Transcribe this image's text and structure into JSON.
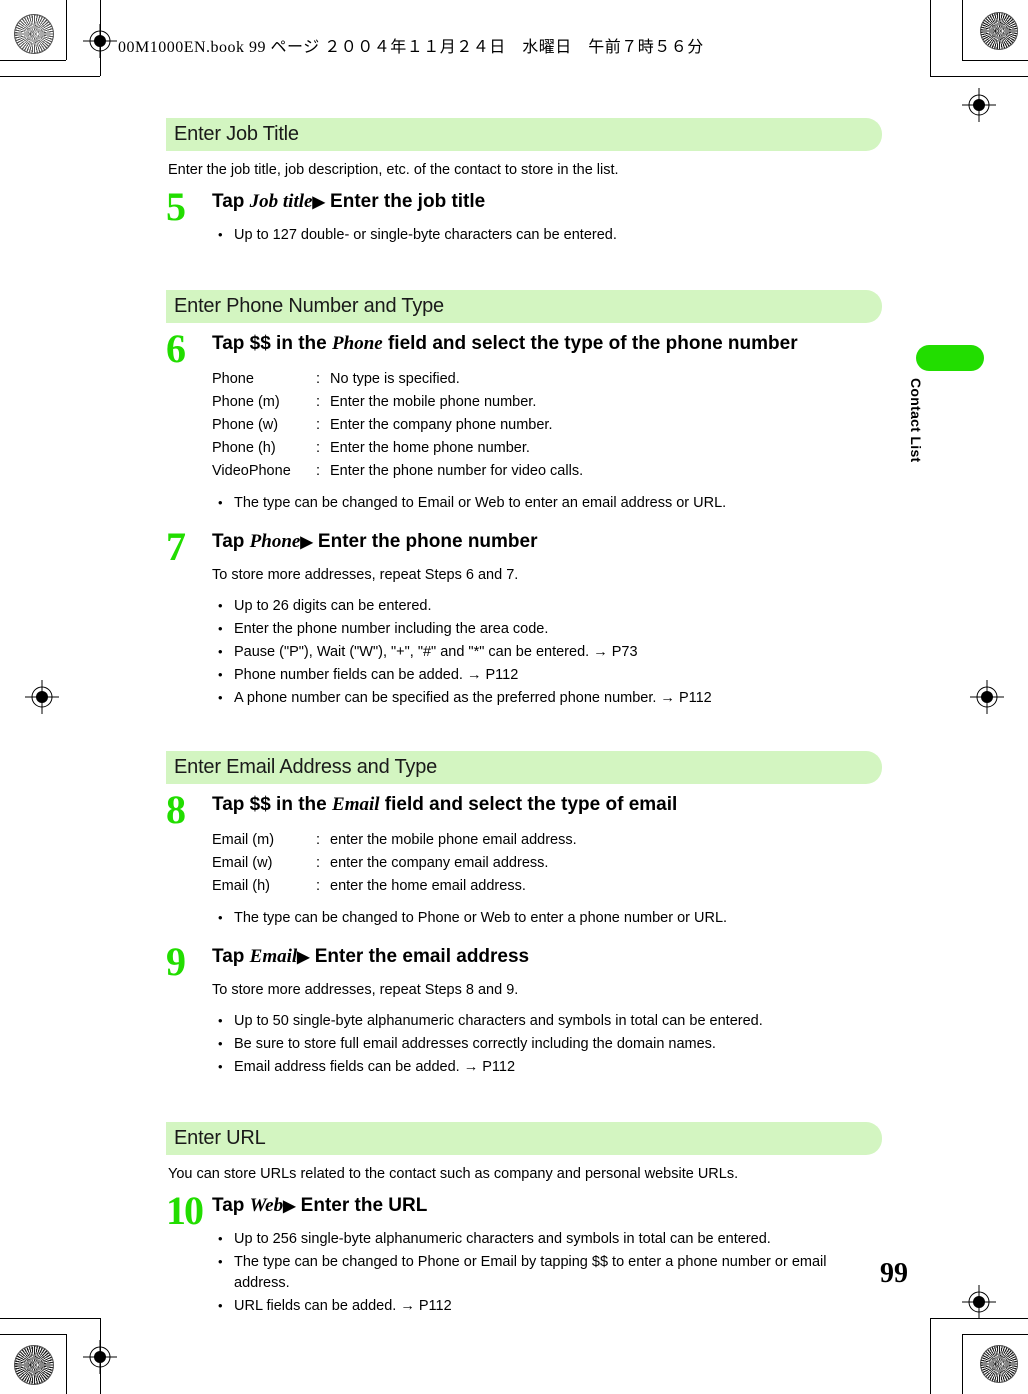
{
  "slug": {
    "text": "00M1000EN.book   99 ページ   ２００４年１１月２４日　水曜日　午前７時５６分"
  },
  "side_tab": {
    "label": "Contact List"
  },
  "folio": {
    "page_number": "99"
  },
  "colors": {
    "band_green": "#d3f5c1",
    "accent_green": "#22dd00",
    "text": "#000000"
  },
  "glyphs": {
    "triangle": "▶",
    "arrow": "→",
    "bullet": "•"
  },
  "sections": [
    {
      "heading": "Enter Job Title",
      "intro": "Enter the job title, job description, etc. of the contact to store in the list.",
      "steps": [
        {
          "number": "5",
          "head_pre": "Tap ",
          "head_field": "Job title",
          "head_post": " Enter the job title",
          "bullets": [
            "Up to 127 double- or single-byte characters can be entered."
          ]
        }
      ]
    },
    {
      "heading": "Enter Phone Number and Type",
      "steps": [
        {
          "number": "6",
          "head_pre": "Tap $$ in the ",
          "head_field": "Phone",
          "head_post": " field and select the type of the phone number",
          "definitions": [
            {
              "term": "Phone",
              "desc": "No type is specified."
            },
            {
              "term": "Phone (m)",
              "desc": "Enter the mobile phone number."
            },
            {
              "term": "Phone (w)",
              "desc": "Enter the company phone number."
            },
            {
              "term": "Phone (h)",
              "desc": "Enter the home phone number."
            },
            {
              "term": "VideoPhone",
              "desc": "Enter the phone number for video calls."
            }
          ],
          "bullets": [
            "The type can be changed to Email or Web to enter an email address or URL."
          ]
        },
        {
          "number": "7",
          "head_pre": "Tap ",
          "head_field": "Phone",
          "head_post": " Enter the phone number",
          "note": "To store more addresses, repeat Steps 6 and 7.",
          "bullets": [
            "Up to 26 digits can be entered.",
            "Enter the phone number including the area code.",
            "Pause (\"P\"), Wait (\"W\"), \"+\", \"#\" and \"*\" can be entered. → P73",
            "Phone number fields can be added. → P112",
            "A phone number can be specified as the preferred phone number. → P112"
          ]
        }
      ]
    },
    {
      "heading": "Enter Email Address and Type",
      "steps": [
        {
          "number": "8",
          "head_pre": "Tap $$ in the ",
          "head_field": "Email",
          "head_post": " field and select the type of email",
          "definitions": [
            {
              "term": "Email (m)",
              "desc": "enter the mobile phone email address."
            },
            {
              "term": "Email (w)",
              "desc": "enter the company email address."
            },
            {
              "term": "Email (h)",
              "desc": "enter the home email address."
            }
          ],
          "bullets": [
            "The type can be changed to Phone or Web to enter a phone number or URL."
          ]
        },
        {
          "number": "9",
          "head_pre": "Tap ",
          "head_field": "Email",
          "head_post": " Enter the email address",
          "note": "To store more addresses, repeat Steps 8 and 9.",
          "bullets": [
            "Up to 50 single-byte alphanumeric characters and symbols in total can be entered.",
            "Be sure to store full email addresses correctly including the domain names.",
            "Email address fields can be added. → P112"
          ]
        }
      ]
    },
    {
      "heading": "Enter URL",
      "intro": "You can store URLs related to the contact such as company and personal website URLs.",
      "steps": [
        {
          "number": "10",
          "head_pre": "Tap ",
          "head_field": "Web",
          "head_post": " Enter the URL",
          "bullets": [
            "Up to 256 single-byte alphanumeric characters and symbols in total can be entered.",
            "The type can be changed to Phone or Email by tapping $$ to enter a phone number or email address.",
            "URL fields can be added. → P112"
          ]
        }
      ]
    }
  ]
}
